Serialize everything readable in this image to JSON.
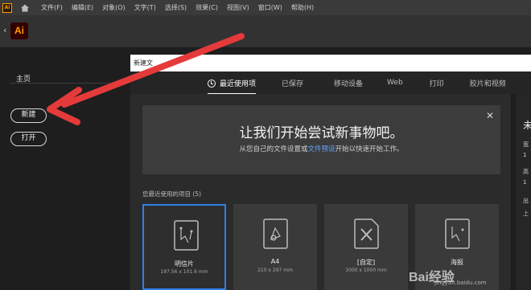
{
  "menubar": {
    "items": [
      "文件(F)",
      "编辑(E)",
      "对象(O)",
      "文字(T)",
      "选择(S)",
      "效果(C)",
      "视图(V)",
      "窗口(W)",
      "帮助(H)"
    ]
  },
  "app": {
    "logo": "Ai"
  },
  "sidebar": {
    "home_label": "主页",
    "new_button": "新建",
    "open_button": "打开"
  },
  "dialog": {
    "top_input": "新建文",
    "tabs": [
      "最近使用项",
      "已保存",
      "移动设备",
      "Web",
      "打印",
      "胶片和视频"
    ],
    "banner": {
      "headline": "让我们开始尝试新事物吧。",
      "sub_before": "从您自己的文件设置或",
      "sub_link": "文件预设",
      "sub_after": "开始以快速开始工作。"
    },
    "recent_label": "您最近使用的项目 (5)",
    "cards": [
      {
        "name": "明信片",
        "dims": "197.56 x 101.6 mm",
        "icon": "postcard-icon",
        "selected": true
      },
      {
        "name": "A4",
        "dims": "210 x 297 mm",
        "icon": "document-icon",
        "selected": false
      },
      {
        "name": "[自定]",
        "dims": "1000 x 1000 mm",
        "icon": "custom-doc-icon",
        "selected": false
      },
      {
        "name": "海报",
        "dims": "",
        "icon": "poster-icon",
        "selected": false
      }
    ],
    "detail": [
      "未",
      "宽",
      "1",
      "高",
      "1",
      "出",
      "上"
    ]
  },
  "watermark": {
    "brand": "Bai经验",
    "url": "jingyan.baidu.com"
  }
}
